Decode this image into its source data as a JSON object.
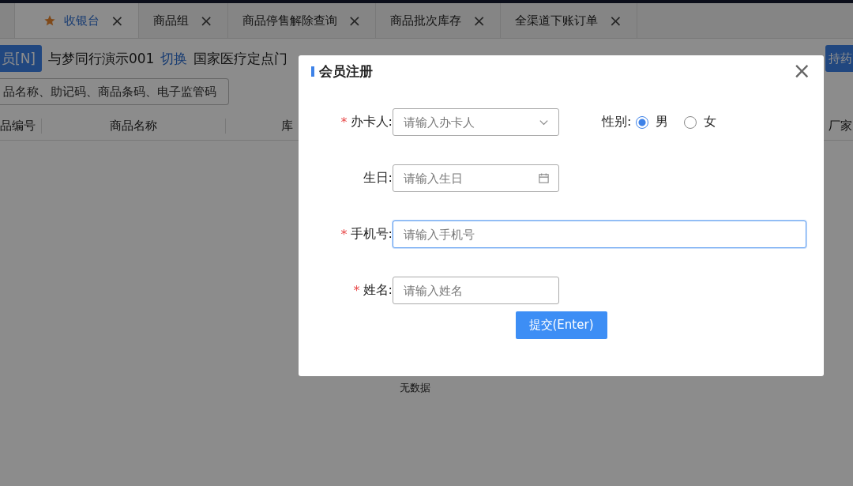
{
  "tabs": [
    {
      "selected": false,
      "starred": false
    },
    {
      "label": "收银台",
      "selected": true,
      "starred": true
    },
    {
      "label": "商品组",
      "selected": false,
      "starred": false
    },
    {
      "label": "商品停售解除查询",
      "selected": false,
      "starred": false
    },
    {
      "label": "商品批次库存",
      "selected": false,
      "starred": false
    },
    {
      "label": "全渠道下账订单",
      "selected": false,
      "starred": false
    }
  ],
  "tab_close": "×",
  "info_bar": {
    "member_button": "员[N]",
    "store": "与梦同行演示001",
    "switch_link": "切换",
    "store_code": "国家医疗定点门",
    "right_button": "持药"
  },
  "search": {
    "placeholder": "品名称、助记码、商品条码、电子监管码"
  },
  "table": {
    "columns": [
      "品编号",
      "商品名称",
      "库",
      "厂家"
    ],
    "empty_text": "无数据"
  },
  "dialog": {
    "title": "会员注册",
    "close": "×",
    "fields": [
      {
        "kind": "select",
        "label": "办卡人:",
        "required": true,
        "placeholder": "请输入办卡人",
        "focused": false,
        "wide": false
      },
      {
        "kind": "date",
        "label": "生日:",
        "required": false,
        "placeholder": "请输入生日",
        "focused": false,
        "wide": false
      },
      {
        "kind": "text",
        "label": "手机号:",
        "required": true,
        "placeholder": "请输入手机号",
        "focused": true,
        "wide": true
      },
      {
        "kind": "text",
        "label": "姓名:",
        "required": true,
        "placeholder": "请输入姓名",
        "focused": false,
        "wide": false
      }
    ],
    "required_mark": "*",
    "gender": {
      "label": "性别:",
      "options": [
        {
          "label": "男",
          "selected": true
        },
        {
          "label": "女",
          "selected": false
        }
      ]
    },
    "submit": "提交(Enter)"
  }
}
